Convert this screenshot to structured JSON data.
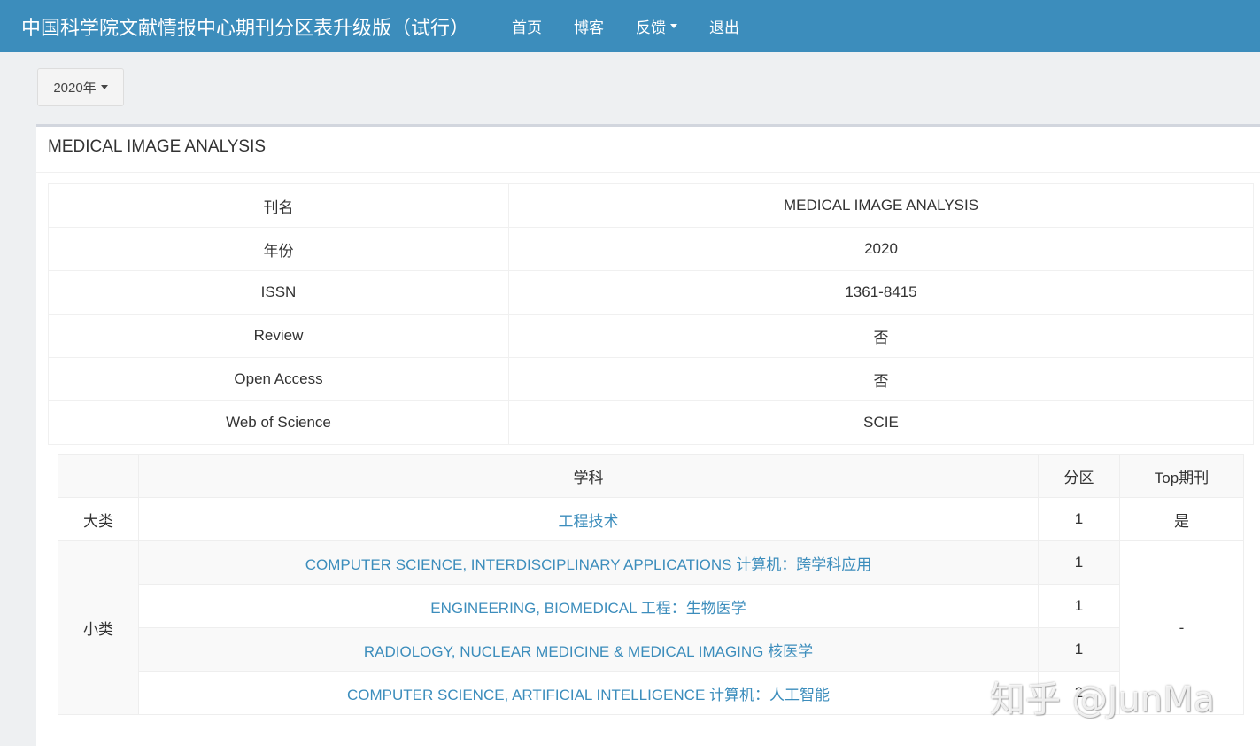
{
  "navbar": {
    "brand": "中国科学院文献情报中心期刊分区表升级版（试行）",
    "items": [
      {
        "label": "首页"
      },
      {
        "label": "博客"
      },
      {
        "label": "反馈"
      },
      {
        "label": "退出"
      }
    ]
  },
  "year_selector": {
    "label": "2020年"
  },
  "panel": {
    "title": "MEDICAL IMAGE ANALYSIS",
    "info_rows": [
      {
        "key": "刊名",
        "value": "MEDICAL IMAGE ANALYSIS"
      },
      {
        "key": "年份",
        "value": "2020"
      },
      {
        "key": "ISSN",
        "value": "1361-8415"
      },
      {
        "key": "Review",
        "value": "否"
      },
      {
        "key": "Open Access",
        "value": "否"
      },
      {
        "key": "Web of Science",
        "value": "SCIE"
      }
    ],
    "subjects": {
      "headers": {
        "subject": "学科",
        "zone": "分区",
        "top": "Top期刊"
      },
      "major": {
        "row_label": "大类",
        "subject": "工程技术",
        "zone": "1",
        "top": "是"
      },
      "minor": {
        "row_label": "小类",
        "top": "-",
        "rows": [
          {
            "subject": "COMPUTER SCIENCE, INTERDISCIPLINARY APPLICATIONS 计算机：跨学科应用",
            "zone": "1"
          },
          {
            "subject": "ENGINEERING, BIOMEDICAL 工程：生物医学",
            "zone": "1"
          },
          {
            "subject": "RADIOLOGY, NUCLEAR MEDICINE & MEDICAL IMAGING 核医学",
            "zone": "1"
          },
          {
            "subject": "COMPUTER SCIENCE, ARTIFICIAL INTELLIGENCE 计算机：人工智能",
            "zone": "2"
          }
        ]
      }
    }
  },
  "watermark": "知乎 @JunMa",
  "colors": {
    "navbar": "#3c8dbc",
    "link": "#3c8dbc"
  }
}
